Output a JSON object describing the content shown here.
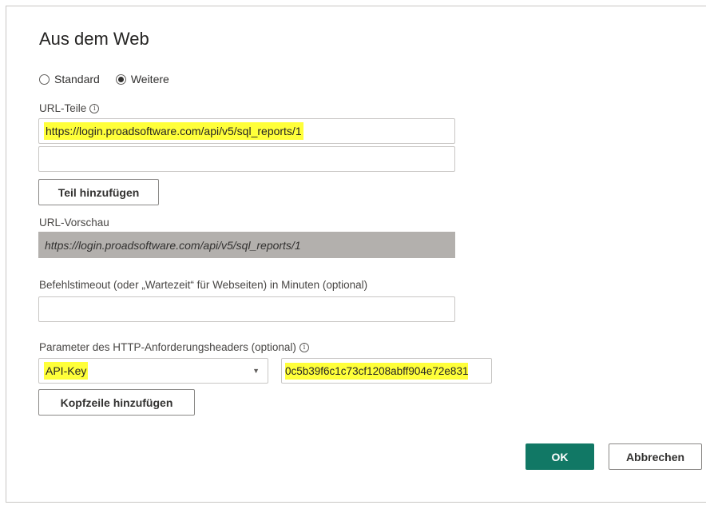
{
  "dialog": {
    "title": "Aus dem Web",
    "radio_standard": "Standard",
    "radio_weitere": "Weitere",
    "selected_mode": "Weitere",
    "url_parts_label": "URL-Teile",
    "url_part_1": "https://login.proadsoftware.com/api/v5/sql_reports/1",
    "url_part_2": "",
    "add_part_button": "Teil hinzufügen",
    "url_preview_label": "URL-Vorschau",
    "url_preview_value": "https://login.proadsoftware.com/api/v5/sql_reports/1",
    "timeout_label": "Befehlstimeout (oder „Wartezeit“ für Webseiten) in Minuten (optional)",
    "timeout_value": "",
    "headers_label": "Parameter des HTTP-Anforderungsheaders (optional)",
    "header_name": "API-Key",
    "header_value": "0c5b39f6c1c73cf1208abff904e72e831",
    "add_header_button": "Kopfzeile hinzufügen",
    "ok_button": "OK",
    "cancel_button": "Abbrechen",
    "info_glyph": "i"
  },
  "colors": {
    "primary": "#117865",
    "highlight": "#ffff3a",
    "preview_bg": "#b3b0ad"
  }
}
